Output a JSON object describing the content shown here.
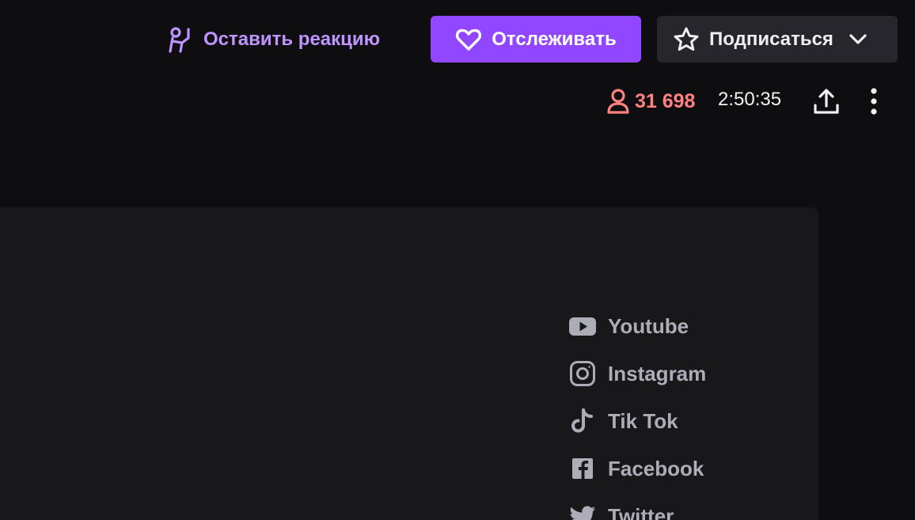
{
  "actions": {
    "react_label": "Оставить реакцию",
    "follow_label": "Отслеживать",
    "subscribe_label": "Подписаться"
  },
  "stats": {
    "viewers": "31 698",
    "uptime": "2:50:35"
  },
  "icons": {
    "react": "react-icon",
    "follow": "heart-icon",
    "subscribe": "star-icon",
    "subscribe_menu": "chevron-down-icon",
    "viewers": "person-icon",
    "share": "share-icon",
    "more": "more-vertical-icon"
  },
  "social_links": [
    {
      "label": "Youtube",
      "icon": "youtube-icon"
    },
    {
      "label": "Instagram",
      "icon": "instagram-icon"
    },
    {
      "label": "Tik Tok",
      "icon": "tiktok-icon"
    },
    {
      "label": "Facebook",
      "icon": "facebook-icon"
    },
    {
      "label": "Twitter",
      "icon": "twitter-icon"
    }
  ],
  "colors": {
    "background": "#0e0e10",
    "panel": "#18181b",
    "accent_purple": "#9147ff",
    "react_purple": "#bf94ff",
    "viewers_red": "#ff8280",
    "secondary_button": "#26262c",
    "link_gray": "#adadb8"
  }
}
